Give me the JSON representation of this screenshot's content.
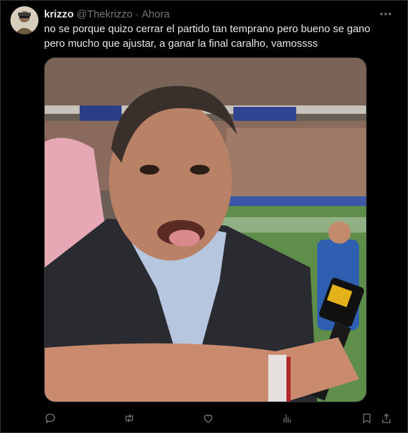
{
  "tweet": {
    "author": {
      "display_name": "krizzo",
      "handle": "@Thekrizzo"
    },
    "separator": "·",
    "timestamp": "Ahora",
    "text": "no se porque quizo cerrar el partido tan temprano pero bueno se gano pero mucho que ajustar, a ganar la final caralho, vamossss"
  },
  "icons": {
    "more": "more-horizontal-icon",
    "reply": "reply-icon",
    "retweet": "retweet-icon",
    "like": "heart-icon",
    "views": "views-chart-icon",
    "bookmark": "bookmark-icon",
    "share": "share-icon"
  },
  "colors": {
    "background": "#000000",
    "text_primary": "#e7e9ea",
    "text_secondary": "#71767b",
    "border": "#2f3336"
  }
}
